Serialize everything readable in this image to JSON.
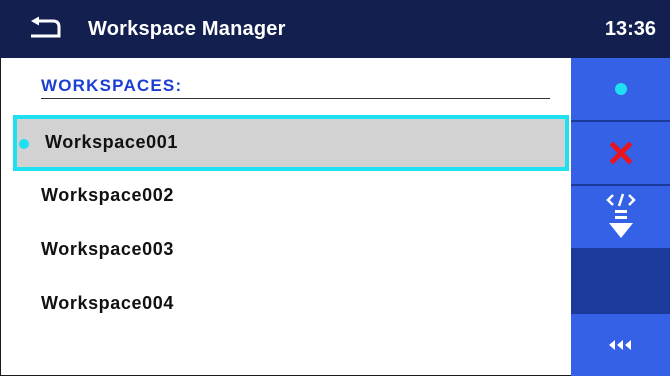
{
  "header": {
    "title": "Workspace Manager",
    "time": "13:36"
  },
  "main": {
    "section_label": "WORKSPACES:",
    "items": [
      {
        "label": "Workspace001",
        "selected": true
      },
      {
        "label": "Workspace002",
        "selected": false
      },
      {
        "label": "Workspace003",
        "selected": false
      },
      {
        "label": "Workspace004",
        "selected": false
      }
    ]
  },
  "sidebar": {
    "buttons": [
      {
        "name": "open-workspace",
        "icon": "dot-icon"
      },
      {
        "name": "delete-workspace",
        "icon": "red-x-icon"
      },
      {
        "name": "export-workspace",
        "icon": "code-download-icon"
      },
      {
        "name": "empty-slot",
        "icon": ""
      },
      {
        "name": "more",
        "icon": "triple-left-arrow-icon"
      }
    ]
  },
  "colors": {
    "header_bg": "#13204f",
    "sidebar_dark": "#1b3a99",
    "sidebar_button": "#3461e6",
    "selection_border": "#1ee0f0",
    "selection_fill": "#d2d2d2",
    "section_label": "#1c3fd1",
    "delete_red": "#e8141e"
  }
}
